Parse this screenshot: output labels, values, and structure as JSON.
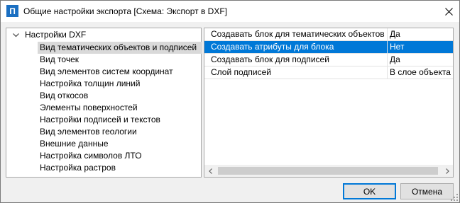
{
  "window": {
    "app_icon_glyph": "П",
    "title": "Общие настройки экспорта [Схема: Экспорт в DXF]"
  },
  "tree": {
    "root_label": "Настройки DXF",
    "items": [
      {
        "label": "Вид тематических объектов и подписей",
        "selected": true
      },
      {
        "label": "Вид точек",
        "selected": false
      },
      {
        "label": "Вид элементов систем координат",
        "selected": false
      },
      {
        "label": "Настройка толщин линий",
        "selected": false
      },
      {
        "label": "Вид откосов",
        "selected": false
      },
      {
        "label": "Элементы поверхностей",
        "selected": false
      },
      {
        "label": "Настройки подписей и текстов",
        "selected": false
      },
      {
        "label": "Вид элементов геологии",
        "selected": false
      },
      {
        "label": "Внешние данные",
        "selected": false
      },
      {
        "label": "Настройка символов ЛТО",
        "selected": false
      },
      {
        "label": "Настройка растров",
        "selected": false
      }
    ]
  },
  "properties": {
    "rows": [
      {
        "name": "Создавать блок для тематических объектов",
        "value": "Да",
        "selected": false
      },
      {
        "name": "Создавать атрибуты для блока",
        "value": "Нет",
        "selected": true
      },
      {
        "name": "Создавать блок для подписей",
        "value": "Да",
        "selected": false
      },
      {
        "name": "Слой подписей",
        "value": "В слое объекта",
        "selected": false
      }
    ]
  },
  "buttons": {
    "ok_label": "OK",
    "cancel_label": "Отмена"
  },
  "colors": {
    "selection": "#0078d7",
    "tree_selection": "#d9d9d9",
    "app_icon": "#1a6fc2"
  }
}
